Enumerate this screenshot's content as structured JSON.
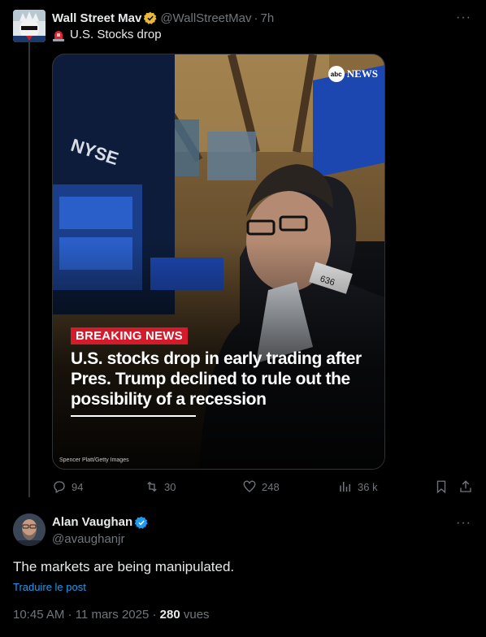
{
  "colors": {
    "background": "#000000",
    "text": "#e7e9ea",
    "muted": "#71767b",
    "link": "#1d9bf0",
    "verified_gold": "#e8b83a",
    "verified_blue": "#1d9bf0",
    "breaking_red": "#d41b2c"
  },
  "post1": {
    "display_name": "Wall Street Mav",
    "handle": "@WallStreetMav",
    "separator": "·",
    "time": "7h",
    "text": "U.S. Stocks drop",
    "text_icon": "siren-icon",
    "badge": "gold-verified-icon",
    "media": {
      "logo_text": "NEWS",
      "logo_circle": "abc",
      "breaking_label": "BREAKING NEWS",
      "headline": "U.S. stocks drop in early trading after Pres. Trump declined to rule out the possibility of a recession",
      "photo_credit": "Spencer Platt/Getty Images"
    },
    "actions": {
      "replies": "94",
      "reposts": "30",
      "likes": "248",
      "views": "36 k"
    }
  },
  "post2": {
    "display_name": "Alan Vaughan",
    "handle": "@avaughanjr",
    "badge": "blue-verified-icon",
    "text": "The markets are being manipulated.",
    "translate_link": "Traduire le post",
    "timestamp": "10:45 AM · 11 mars 2025 · ",
    "views_count": "280",
    "views_label": " vues"
  }
}
